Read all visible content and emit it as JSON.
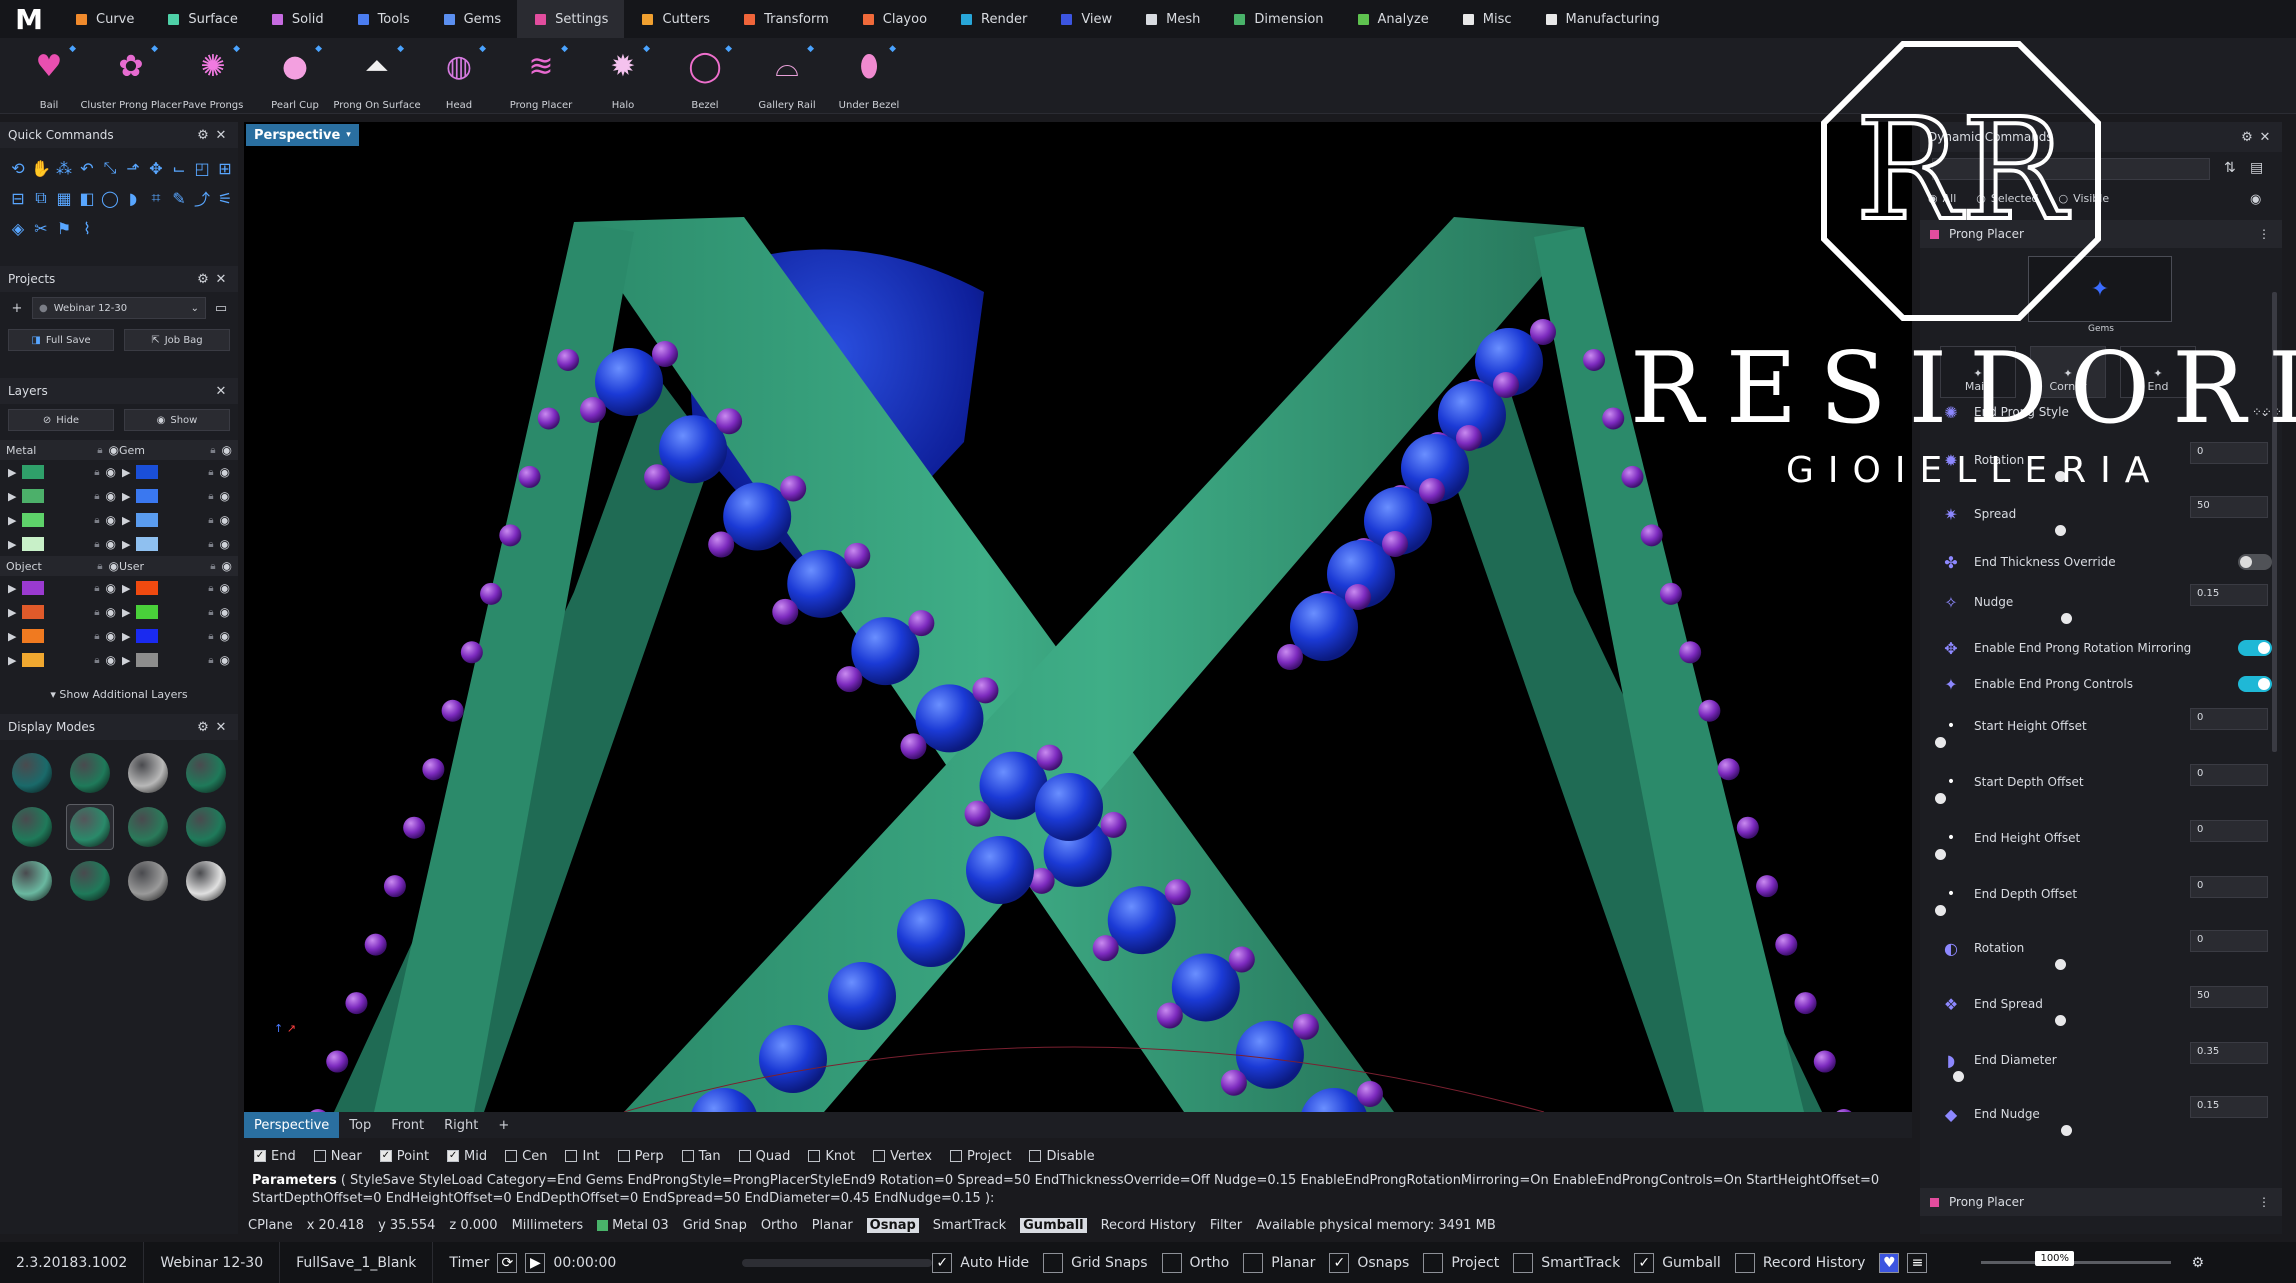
{
  "menu": {
    "logo": "M",
    "items": [
      {
        "label": "Curve",
        "color": "#f08a2c"
      },
      {
        "label": "Surface",
        "color": "#4fd1a8"
      },
      {
        "label": "Solid",
        "color": "#c66be0"
      },
      {
        "label": "Tools",
        "color": "#4b7df0"
      },
      {
        "label": "Gems",
        "color": "#5b8ff0"
      },
      {
        "label": "Settings",
        "color": "#e24d9e"
      },
      {
        "label": "Cutters",
        "color": "#f0a030"
      },
      {
        "label": "Transform",
        "color": "#f0653a"
      },
      {
        "label": "Clayoo",
        "color": "#f06a3a"
      },
      {
        "label": "Render",
        "color": "#28a6d8"
      },
      {
        "label": "View",
        "color": "#3c55e0"
      },
      {
        "label": "Mesh",
        "color": "#d8dbe0"
      },
      {
        "label": "Dimension",
        "color": "#49b36a"
      },
      {
        "label": "Analyze",
        "color": "#5ec24f"
      },
      {
        "label": "Misc",
        "color": "#e8e8e8"
      },
      {
        "label": "Manufacturing",
        "color": "#e8e8e8"
      }
    ]
  },
  "ribbon": {
    "tools": [
      {
        "label": "Bail",
        "icon": "bail-icon"
      },
      {
        "label": "Cluster Prong Placer",
        "icon": "cluster-prong-icon"
      },
      {
        "label": "Pave Prongs",
        "icon": "pave-prongs-icon"
      },
      {
        "label": "Pearl Cup",
        "icon": "pearl-cup-icon"
      },
      {
        "label": "Prong On Surface",
        "icon": "prong-on-surface-icon"
      },
      {
        "label": "Head",
        "icon": "head-icon"
      },
      {
        "label": "Prong Placer",
        "icon": "prong-placer-icon"
      },
      {
        "label": "Halo",
        "icon": "halo-icon"
      },
      {
        "label": "Bezel",
        "icon": "bezel-icon"
      },
      {
        "label": "Gallery Rail",
        "icon": "gallery-rail-icon"
      },
      {
        "label": "Under Bezel",
        "icon": "under-bezel-icon"
      }
    ]
  },
  "quick_commands": {
    "title": "Quick Commands"
  },
  "projects": {
    "title": "Projects",
    "selected": "Webinar 12-30",
    "full_save": "Full Save",
    "job_bag": "Job Bag"
  },
  "layers": {
    "title": "Layers",
    "hide": "Hide",
    "show": "Show",
    "groups": [
      {
        "name": "Metal",
        "colors": [
          "#2fa06a",
          "#4cb06a",
          "#5ed26a",
          "#c8f0c8"
        ]
      },
      {
        "name": "Gem",
        "colors": [
          "#1a4fd8",
          "#3a78f0",
          "#5a9cf0",
          "#8fc0f0"
        ]
      },
      {
        "name": "Object",
        "colors": [
          "#9a3ad0",
          "#e05a2a",
          "#f07a20",
          "#f0a830"
        ]
      },
      {
        "name": "User",
        "colors": [
          "#f04a10",
          "#49d03a",
          "#1a2af0",
          "#8d8d8d"
        ]
      }
    ],
    "show_additional": "Show Additional Layers"
  },
  "display_modes": {
    "title": "Display Modes"
  },
  "viewport": {
    "name": "Perspective",
    "tabs": [
      "Perspective",
      "Top",
      "Front",
      "Right"
    ]
  },
  "osnap": [
    {
      "label": "End",
      "on": true
    },
    {
      "label": "Near",
      "on": false
    },
    {
      "label": "Point",
      "on": true
    },
    {
      "label": "Mid",
      "on": true
    },
    {
      "label": "Cen",
      "on": false
    },
    {
      "label": "Int",
      "on": false
    },
    {
      "label": "Perp",
      "on": false
    },
    {
      "label": "Tan",
      "on": false
    },
    {
      "label": "Quad",
      "on": false
    },
    {
      "label": "Knot",
      "on": false
    },
    {
      "label": "Vertex",
      "on": false
    },
    {
      "label": "Project",
      "on": false
    },
    {
      "label": "Disable",
      "on": false
    }
  ],
  "command": {
    "prefix": "Parameters",
    "line1": "( StyleSave  StyleLoad  Category=End  Gems  EndProngStyle=ProngPlacerStyleEnd9  Rotation=0  Spread=50  EndThicknessOverride=Off  Nudge=0.15  EnableEndProngRotationMirroring=On  EnableEndProngControls=On  StartHeightOffset=0",
    "line2": "StartDepthOffset=0  EndHeightOffset=0  EndDepthOffset=0  EndSpread=50  EndDiameter=0.45  EndNudge=0.15 ):"
  },
  "status": {
    "cplane": "CPlane",
    "x": "x 20.418",
    "y": "y 35.554",
    "z": "z 0.000",
    "units": "Millimeters",
    "layer": "Metal 03",
    "grid_snap": "Grid Snap",
    "ortho": "Ortho",
    "planar": "Planar",
    "osnap": "Osnap",
    "smarttrack": "SmartTrack",
    "gumball": "Gumball",
    "record_history": "Record History",
    "filter": "Filter",
    "memory": "Available physical memory: 3491 MB"
  },
  "bottombar": {
    "version": "2.3.20183.1002",
    "project": "Webinar 12-30",
    "file": "FullSave_1_Blank",
    "timer_label": "Timer",
    "timer_value": "00:00:00",
    "toggles": [
      {
        "label": "Auto Hide",
        "on": true
      },
      {
        "label": "Grid Snaps",
        "on": false
      },
      {
        "label": "Ortho",
        "on": false
      },
      {
        "label": "Planar",
        "on": false
      },
      {
        "label": "Osnaps",
        "on": true
      },
      {
        "label": "Project",
        "on": false
      },
      {
        "label": "SmartTrack",
        "on": false
      },
      {
        "label": "Gumball",
        "on": true
      },
      {
        "label": "Record History",
        "on": false
      }
    ],
    "zoom": "100%"
  },
  "right_panel": {
    "title_partial": "Dynamic Commands",
    "filters": [
      "All",
      "Selected",
      "Visible"
    ],
    "section": "Prong Placer",
    "preview_label": "Gems",
    "tabs": [
      "Main",
      "Corner",
      "End"
    ],
    "rows": [
      {
        "label": "End Prong Style",
        "kind": "style"
      },
      {
        "label": "Rotation",
        "kind": "slider",
        "value": "0",
        "fill": 0.4
      },
      {
        "label": "Spread",
        "kind": "slider",
        "value": "50",
        "fill": 0.4
      },
      {
        "label": "End Thickness Override",
        "kind": "toggle",
        "on": false
      },
      {
        "label": "Nudge",
        "kind": "slider",
        "value": "0.15",
        "fill": 0.42
      },
      {
        "label": "Enable End Prong Rotation Mirroring",
        "kind": "toggle",
        "on": true
      },
      {
        "label": "Enable End Prong Controls",
        "kind": "toggle",
        "on": true
      },
      {
        "label": "Start Height Offset",
        "kind": "slider",
        "value": "0",
        "fill": 0.0
      },
      {
        "label": "Start Depth Offset",
        "kind": "slider",
        "value": "0",
        "fill": 0.0
      },
      {
        "label": "End Height Offset",
        "kind": "slider",
        "value": "0",
        "fill": 0.0
      },
      {
        "label": "End Depth Offset",
        "kind": "slider",
        "value": "0",
        "fill": 0.0
      },
      {
        "label": "Rotation",
        "kind": "slider",
        "value": "0",
        "fill": 0.4
      },
      {
        "label": "End Spread",
        "kind": "slider",
        "value": "50",
        "fill": 0.4
      },
      {
        "label": "End Diameter",
        "kind": "slider",
        "value": "0.35",
        "fill": 0.06
      },
      {
        "label": "End Nudge",
        "kind": "slider",
        "value": "0.15",
        "fill": 0.42
      }
    ],
    "footer": "Prong Placer"
  },
  "watermark": {
    "monogram": "RR",
    "brand": "RESIDORI",
    "sub": "GIOIELLERIA"
  }
}
